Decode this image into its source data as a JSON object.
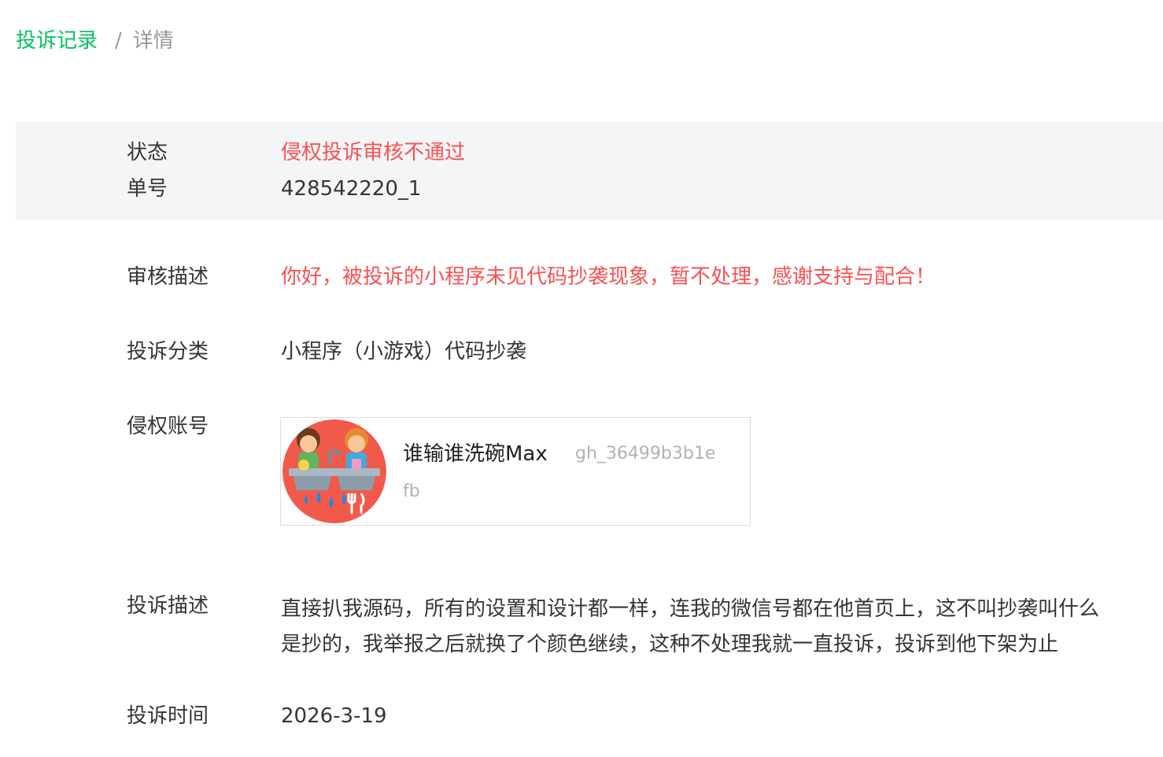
{
  "breadcrumb": {
    "parent": "投诉记录",
    "separator": "/",
    "current": "详情"
  },
  "summary": {
    "status_label": "状态",
    "status_value": "侵权投诉审核不通过",
    "order_label": "单号",
    "order_value": "428542220_1"
  },
  "review": {
    "label": "审核描述",
    "value": "你好，被投诉的小程序未见代码抄袭现象，暂不处理，感谢支持与配合！"
  },
  "category": {
    "label": "投诉分类",
    "value": "小程序（小游戏）代码抄袭"
  },
  "infringing_account": {
    "label": "侵权账号",
    "name": "谁输谁洗碗Max",
    "id_line1": "gh_36499b3b1e",
    "id_line2": "fb",
    "avatar_icon": "dishwashing-kids-avatar-icon"
  },
  "complaint_desc": {
    "label": "投诉描述",
    "line1": "直接扒我源码，所有的设置和设计都一样，连我的微信号都在他首页上，这不叫抄袭叫什么",
    "line2": "是抄的，我举报之后就换了个颜色继续，这种不处理我就一直投诉，投诉到他下架为止"
  },
  "complaint_time": {
    "label": "投诉时间",
    "value": "2026-3-19"
  },
  "colors": {
    "accent_green": "#07c160",
    "error_red": "#fa5151",
    "summary_bg": "#f4f5f7"
  }
}
